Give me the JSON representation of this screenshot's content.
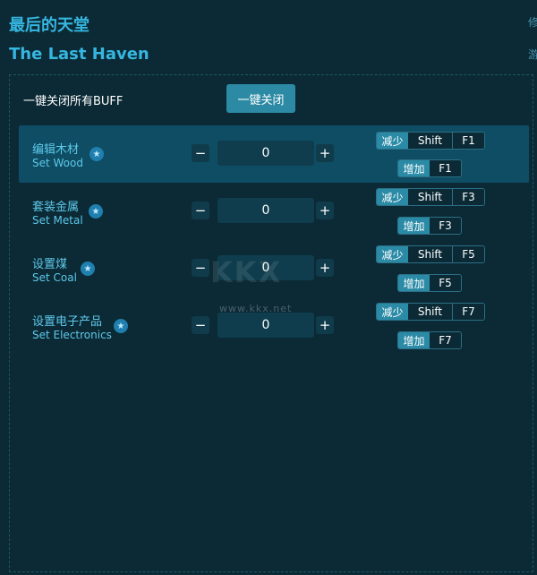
{
  "header": {
    "title_cn": "最后的天堂",
    "title_en": "The Last Haven",
    "edge_right_1": "修",
    "edge_right_2": "游"
  },
  "toolbar": {
    "buff_label": "一键关闭所有BUFF",
    "close_all_label": "一键关闭"
  },
  "rows": [
    {
      "name_cn": "编辑木材",
      "name_en": "Set Wood",
      "value": "0",
      "dec_label": "减少",
      "dec_mod": "Shift",
      "dec_key": "F1",
      "inc_label": "增加",
      "inc_key": "F1"
    },
    {
      "name_cn": "套装金属",
      "name_en": "Set Metal",
      "value": "0",
      "dec_label": "减少",
      "dec_mod": "Shift",
      "dec_key": "F3",
      "inc_label": "增加",
      "inc_key": "F3"
    },
    {
      "name_cn": "设置煤",
      "name_en": "Set Coal",
      "value": "0",
      "dec_label": "减少",
      "dec_mod": "Shift",
      "dec_key": "F5",
      "inc_label": "增加",
      "inc_key": "F5"
    },
    {
      "name_cn": "设置电子产品",
      "name_en": "Set Electronics",
      "value": "0",
      "dec_label": "减少",
      "dec_mod": "Shift",
      "dec_key": "F7",
      "inc_label": "增加",
      "inc_key": "F7"
    }
  ],
  "controls": {
    "minus_symbol": "−",
    "plus_symbol": "+",
    "star_icon": "star-icon"
  },
  "watermark": {
    "logo_text": "KKX",
    "url": "www.kkx.net"
  },
  "colors": {
    "background": "#0b2a35",
    "accent": "#36b6e0",
    "active_row": "#0e4d63",
    "button": "#2c8aa4"
  }
}
